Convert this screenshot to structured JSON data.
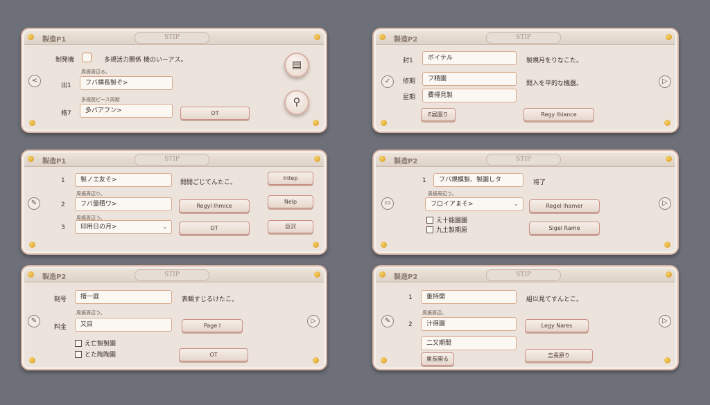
{
  "panel1": {
    "title": "製造P1",
    "title_pill": "STIP",
    "label1": "制発機",
    "label2": "出1",
    "label3": "格7",
    "top_text": "多規活力關係 機のいーアス。",
    "small1": "周振周辺る。",
    "small2": "多規罠ピース周期",
    "input2": "フバ横長製ぞ>",
    "input3": "多バアフン>",
    "btn_ok": "OT",
    "nav_left": "<",
    "round1_icon": "▤",
    "round2_icon": "⚲"
  },
  "panel2": {
    "title": "製造P2",
    "title_pill": "STIP",
    "label1": "封1",
    "label2": "修期",
    "label3": "星期",
    "input1": "ボイテル",
    "input2": "フ精園",
    "input3": "費得見製",
    "text1": "製規月をりなこた。",
    "text2": "開入を平的な機器。",
    "btn_small": "E展園り",
    "btn_main": "Regy lhiance",
    "nav_left": "✓",
    "nav_right": "▷"
  },
  "panel3": {
    "title": "製造P1",
    "title_pill": "STIP",
    "n1": "1",
    "n2": "2",
    "n3": "3",
    "input1": "製ノエ友そ>",
    "input2": "フバ量積ワ>",
    "input3": "印用日の月>",
    "small1": "周振周辺り。",
    "small2": "周振周辺う。",
    "text1": "開開ごじてんたこ。",
    "btn_mid": "Regyl lhmice",
    "btn_ok": "OT",
    "btn_r1": "Intep",
    "btn_r2": "Nelp",
    "btn_r3": "巨沢",
    "nav_left": "✎"
  },
  "panel4": {
    "title": "製造P2",
    "title_pill": "STIP",
    "n1": "1",
    "input1": "フバ規模製、製園しタ",
    "text1": "将了",
    "small1": "周振周辺う。",
    "select1": "フロイアまそ>",
    "cb1": "え十能園園",
    "cb2": "九土製期原",
    "btn1": "Regel lhamer",
    "btn2": "Sigel Rame",
    "nav_left": "▭",
    "nav_right": "▷"
  },
  "panel5": {
    "title": "製造P2",
    "title_pill": "STIP",
    "label1": "制号",
    "label2": "料金",
    "input1": "措一庭",
    "input2": "又目",
    "small1": "周振周辺う。",
    "text1": "表観すじるけたこ。",
    "cb1": "え亡製製園",
    "cb2": "とた陶陶園",
    "btn1": "Page l",
    "btn_ok": "OT",
    "nav_left": "✎",
    "nav_right": "▷"
  },
  "panel6": {
    "title": "製造P2",
    "title_pill": "STIP",
    "n1": "1",
    "n2": "2",
    "input1": "董持開",
    "input2": "汁得園",
    "input3": "二又期間",
    "small1": "周振周辺。",
    "text1": "組以見てすんとこ。",
    "btn1": "Legy Nares",
    "btn_small": "東長開る",
    "btn_main": "吉長原り",
    "nav_left": "✎",
    "nav_right": "▷"
  }
}
